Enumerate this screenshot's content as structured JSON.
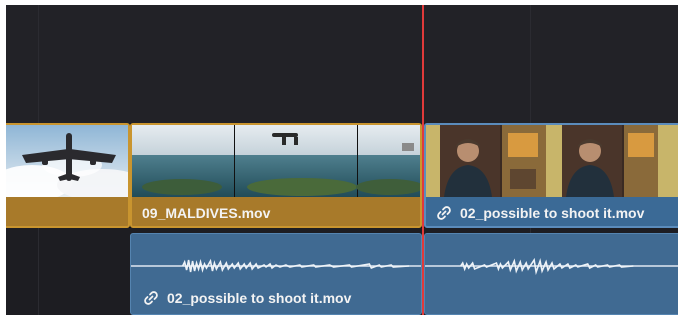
{
  "timeline": {
    "video_clips": [
      {
        "id": "airplane-clip",
        "label": ""
      },
      {
        "id": "maldives-clip",
        "label": "09_MALDIVES.mov"
      },
      {
        "id": "interview-video-clip",
        "label": "02_possible to shoot it.mov",
        "linked": true
      }
    ],
    "audio_clips": [
      {
        "id": "interview-audio-clip-a",
        "label": "02_possible to shoot it.mov",
        "linked": true
      },
      {
        "id": "interview-audio-clip-b",
        "label": ""
      }
    ],
    "colors": {
      "video_clip_selected": "#a87a2a",
      "video_clip": "#3b6a96",
      "audio_clip": "#406a92",
      "playhead": "#e03a3a",
      "background": "#1d1d22"
    },
    "icons": [
      "link-icon"
    ]
  }
}
